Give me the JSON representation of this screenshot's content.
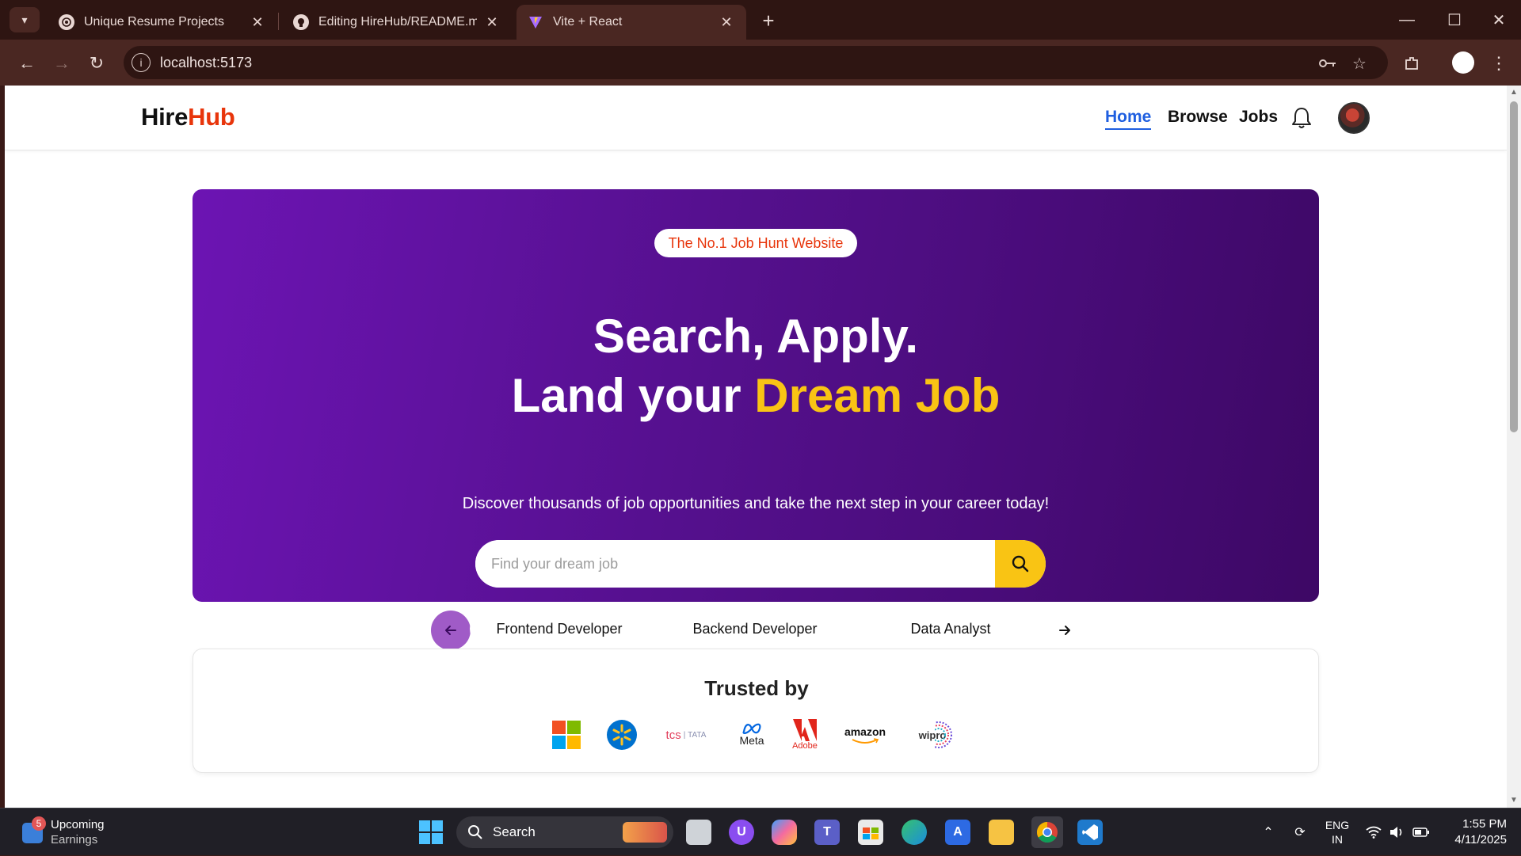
{
  "browser": {
    "tabs": [
      {
        "title": "Unique Resume Projects",
        "icon": "chatgpt-icon"
      },
      {
        "title": "Editing HireHub/README.md at",
        "icon": "github-icon"
      },
      {
        "title": "Vite + React",
        "icon": "vite-icon",
        "active": true
      }
    ],
    "url": "localhost:5173"
  },
  "site": {
    "logo": {
      "part1": "Hire",
      "part2": "Hub"
    },
    "nav": [
      {
        "label": "Home",
        "active": true
      },
      {
        "label": "Browse"
      },
      {
        "label": "Jobs"
      }
    ]
  },
  "hero": {
    "badge": "The No.1 Job Hunt Website",
    "title_line1": "Search, Apply.",
    "title_line2_prefix": "Land your ",
    "title_line2_accent": "Dream Job",
    "subtitle": "Discover thousands of job opportunities and take the next step in your career today!",
    "search_placeholder": "Find your dream job",
    "categories": [
      "Frontend Developer",
      "Backend Developer",
      "Data Analyst"
    ]
  },
  "trusted": {
    "title": "Trusted by",
    "companies": [
      "Microsoft",
      "Walmart",
      "tcs",
      "Meta",
      "Adobe",
      "amazon",
      "wipro"
    ]
  },
  "taskbar": {
    "weather_count": "5",
    "weather_line1": "Upcoming",
    "weather_line2": "Earnings",
    "search_label": "Search",
    "lang_line1": "ENG",
    "lang_line2": "IN",
    "time": "1:55 PM",
    "date": "4/11/2025"
  },
  "colors": {
    "brand_orange": "#e8350b",
    "accent_yellow": "#f9c414",
    "hero_purple": "#5a0f99",
    "nav_active": "#1f5fe0"
  }
}
